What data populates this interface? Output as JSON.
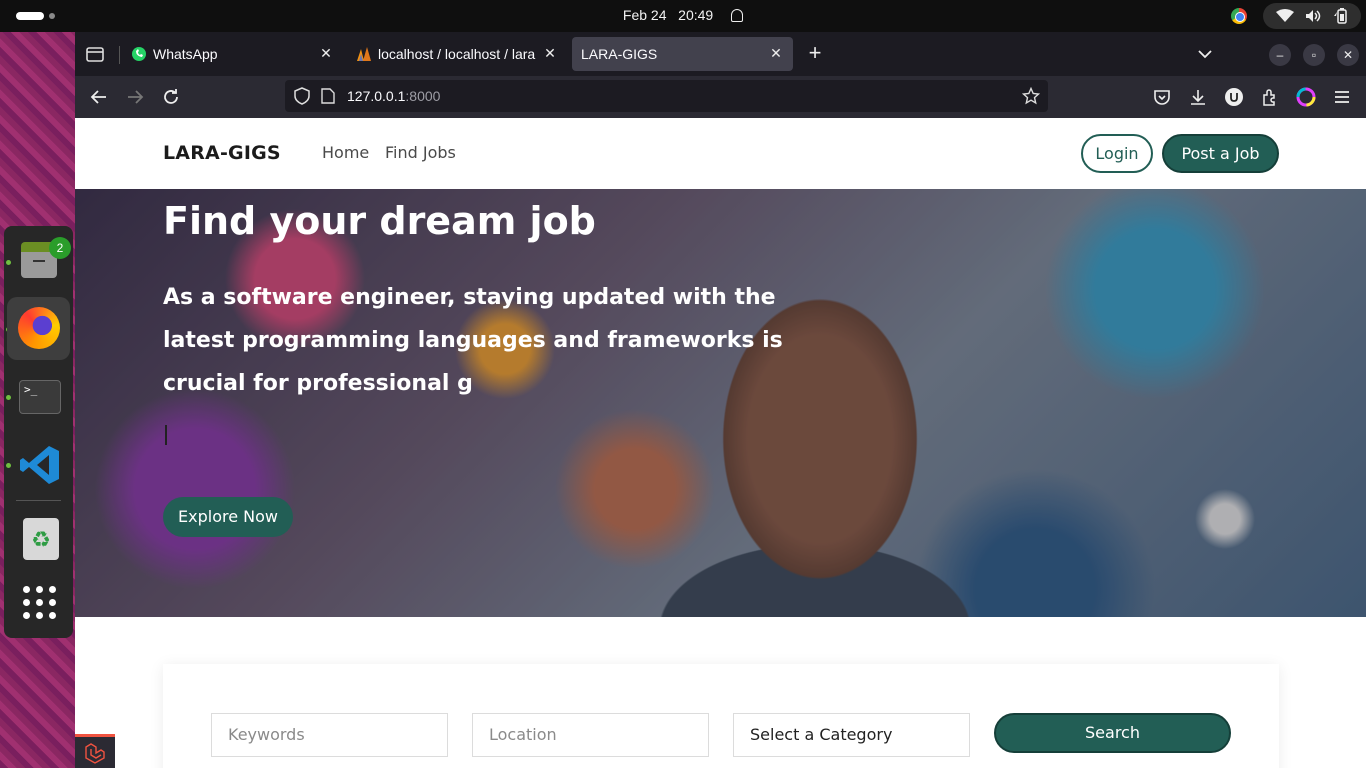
{
  "system": {
    "clock_date": "Feb 24",
    "clock_time": "20:49",
    "files_badge": "2",
    "terminal_prompt": ">_",
    "trash_symbol": "♻"
  },
  "browser": {
    "tabs": [
      {
        "title": "WhatsApp",
        "icon": "whatsapp-icon"
      },
      {
        "title": "localhost / localhost / lara",
        "icon": "phpmyadmin-icon"
      },
      {
        "title": "LARA-GIGS",
        "icon": "page-icon"
      }
    ],
    "url_host": "127.0.0.1",
    "url_port": ":8000"
  },
  "site": {
    "brand": "LARA-GIGS",
    "nav": {
      "home": "Home",
      "find_jobs": "Find Jobs"
    },
    "login_label": "Login",
    "post_job_label": "Post a Job",
    "hero": {
      "title": "Find your dream job",
      "text": "As a software engineer, staying updated with the latest programming languages and frameworks is crucial for professional g",
      "cta": "Explore Now"
    },
    "search": {
      "keywords_placeholder": "Keywords",
      "location_placeholder": "Location",
      "category_selected": "Select a Category",
      "button": "Search"
    }
  },
  "colors": {
    "accent": "#225e55",
    "tab_active": "#42414d",
    "toolbar": "#2b2a33"
  }
}
